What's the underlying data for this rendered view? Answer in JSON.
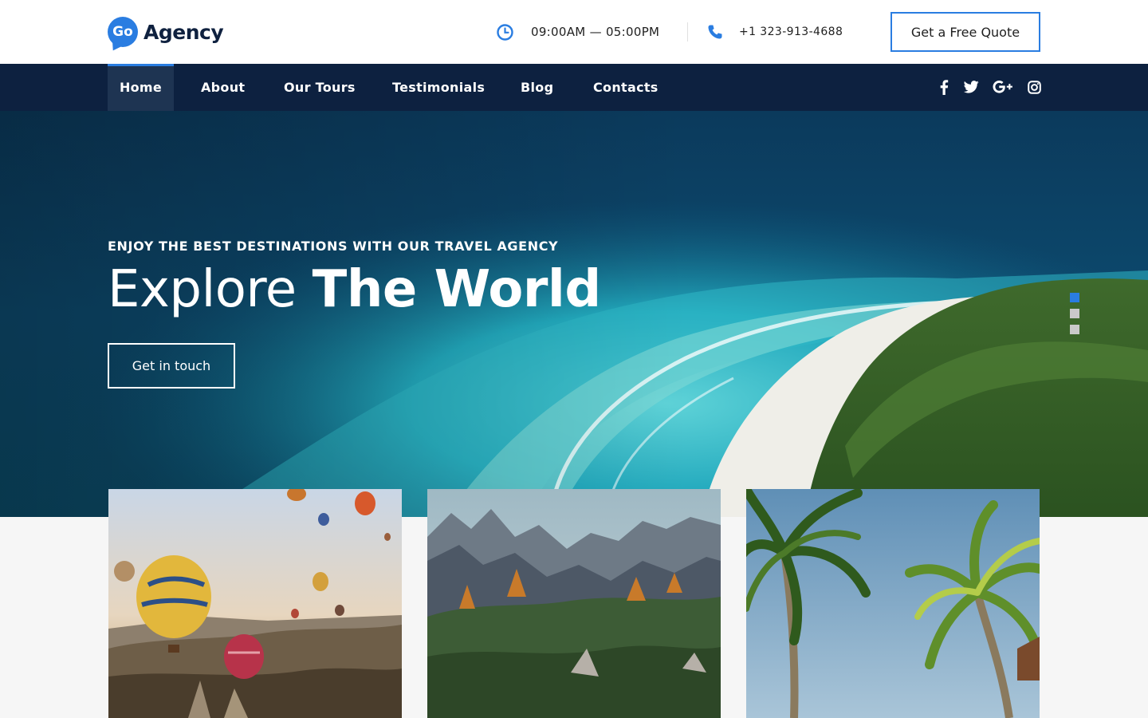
{
  "brand": {
    "badge": "Go",
    "name": "Agency"
  },
  "header": {
    "hours": "09:00AM — 05:00PM",
    "phone": "+1 323-913-4688",
    "quote_button": "Get a Free Quote"
  },
  "nav": {
    "items": [
      {
        "label": "Home",
        "active": true
      },
      {
        "label": "About",
        "active": false
      },
      {
        "label": "Our Tours",
        "active": false
      },
      {
        "label": "Testimonials",
        "active": false
      },
      {
        "label": "Blog",
        "active": false
      },
      {
        "label": "Contacts",
        "active": false
      }
    ],
    "social": [
      "facebook-icon",
      "twitter-icon",
      "google-plus-icon",
      "instagram-icon"
    ]
  },
  "hero": {
    "subtitle": "ENJOY THE BEST DESTINATIONS WITH OUR TRAVEL AGENCY",
    "title_light": "Explore",
    "title_bold": "The World",
    "cta": "Get in touch",
    "slides": {
      "count": 3,
      "active": 1
    }
  },
  "cards": [
    {
      "image": "hot-air-balloons-photo"
    },
    {
      "image": "mountain-range-photo"
    },
    {
      "image": "palm-trees-photo"
    }
  ],
  "colors": {
    "accent": "#2a7de1",
    "nav_bg": "#0d2140",
    "brand_text": "#0f213f"
  }
}
